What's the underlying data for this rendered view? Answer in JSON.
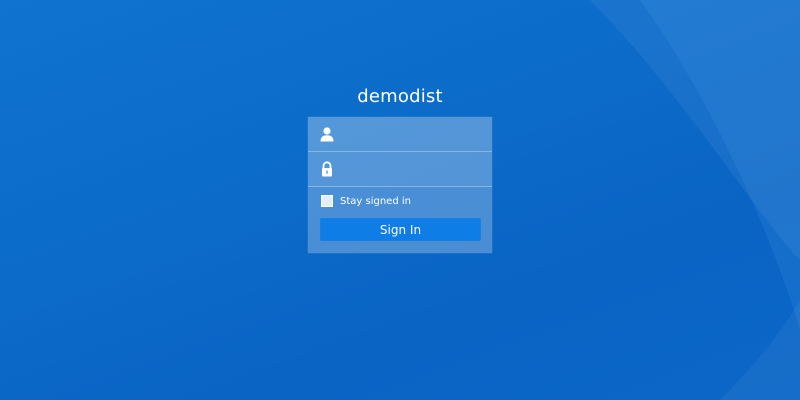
{
  "login": {
    "site_name": "demodist",
    "username": {
      "value": "",
      "placeholder": "",
      "icon": "user-icon"
    },
    "password": {
      "value": "",
      "placeholder": "",
      "icon": "lock-icon"
    },
    "remember_label": "Stay signed in",
    "remember_checked": false,
    "signin_label": "Sign In"
  },
  "colors": {
    "background": "#0c6bc9",
    "button": "#0f7de6",
    "text": "#ffffff"
  }
}
